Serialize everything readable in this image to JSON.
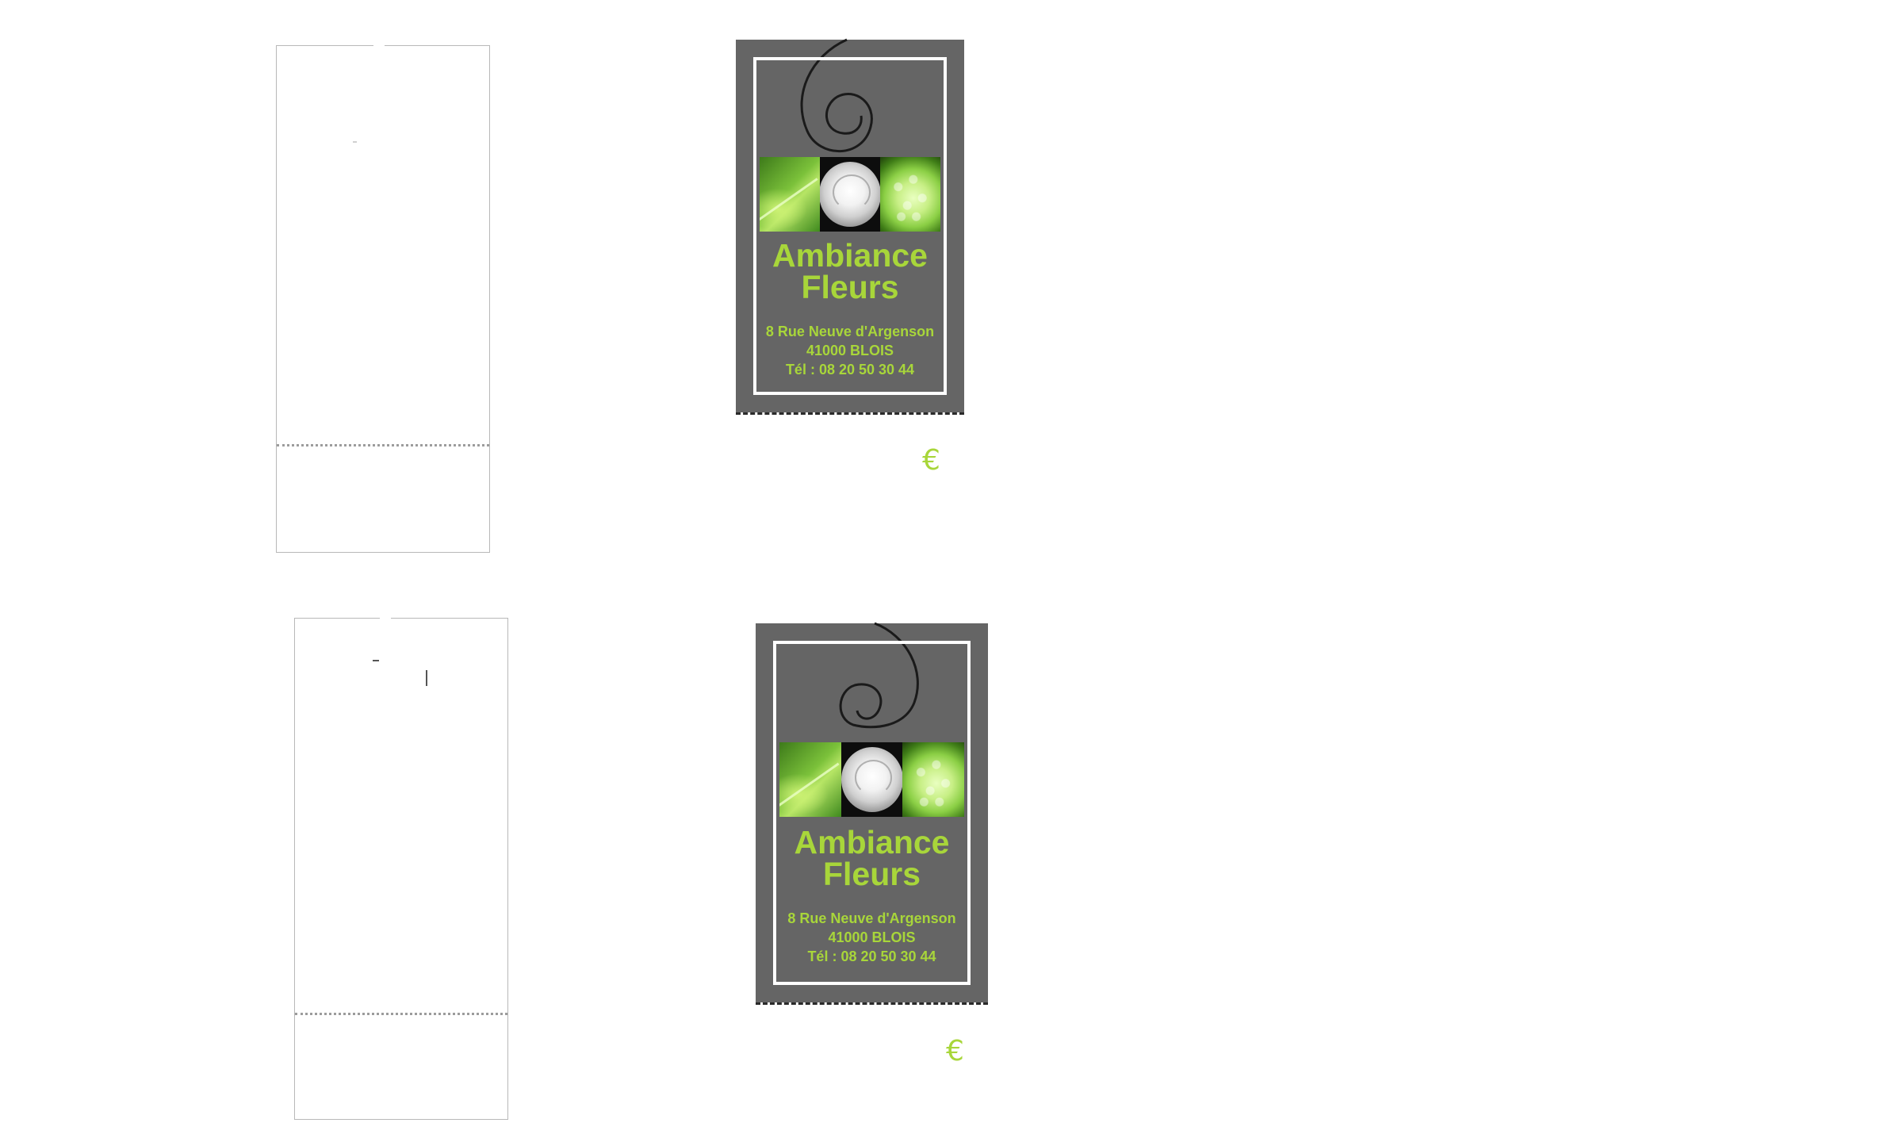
{
  "tags": [
    {
      "brand_line1": "Ambiance",
      "brand_line2": "Fleurs",
      "address_line1": "8 Rue Neuve d'Argenson",
      "address_line2": "41000 BLOIS",
      "phone": "Tél : 08 20 50 30 44",
      "price_symbol": "€",
      "photos": [
        "leaf-with-water-drop",
        "white-rose",
        "green-hydrangea"
      ]
    },
    {
      "brand_line1": "Ambiance",
      "brand_line2": "Fleurs",
      "address_line1": "8 Rue Neuve d'Argenson",
      "address_line2": "41000 BLOIS",
      "phone": "Tél : 08 20 50 30 44",
      "price_symbol": "€",
      "photos": [
        "leaf-with-water-drop",
        "white-rose",
        "green-hydrangea"
      ]
    }
  ],
  "colors": {
    "tag_background": "#656565",
    "brand_green": "#a8d63a",
    "frame": "#ffffff"
  }
}
